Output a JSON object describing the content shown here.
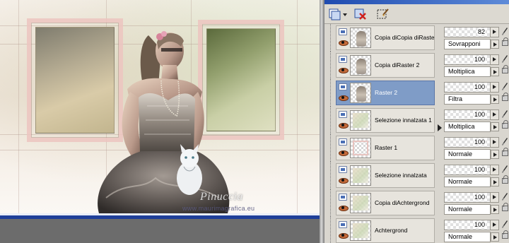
{
  "watermark": {
    "name": "Pinuccia",
    "url": "www.maurimagrafica.eu"
  },
  "toolbar": {
    "buttons": [
      {
        "icon": "new-raster-layer-icon",
        "has_dropdown": true
      },
      {
        "icon": "delete-layer-icon"
      },
      {
        "icon": "edit-selection-icon"
      }
    ]
  },
  "layers": [
    {
      "name": "Copia diCopia diRaster",
      "opacity": "82",
      "blend": "Sovrapponi",
      "thumb": "figure",
      "selected": false
    },
    {
      "name": "Copia diRaster 2",
      "opacity": "100",
      "blend": "Moltiplica",
      "thumb": "figure",
      "selected": false
    },
    {
      "name": "Raster 2",
      "opacity": "100",
      "blend": "Filtra",
      "thumb": "figure",
      "selected": true
    },
    {
      "name": "Selezione innalzata 1",
      "opacity": "100",
      "blend": "Moltiplica",
      "thumb": "soft",
      "selected": false
    },
    {
      "name": "Raster 1",
      "opacity": "100",
      "blend": "Normale",
      "thumb": "pink",
      "selected": false
    },
    {
      "name": "Selezione innalzata",
      "opacity": "100",
      "blend": "Normale",
      "thumb": "soft",
      "selected": false
    },
    {
      "name": "Copia diAchtergrond",
      "opacity": "100",
      "blend": "Normale",
      "thumb": "soft",
      "selected": false
    },
    {
      "name": "Achtergrond",
      "opacity": "100",
      "blend": "Normale",
      "thumb": "soft",
      "selected": false
    }
  ],
  "colors": {
    "selected_row": "#7f9cc7",
    "title_bar": "#1f4bb0",
    "canvas_band": "#1f3f99"
  }
}
